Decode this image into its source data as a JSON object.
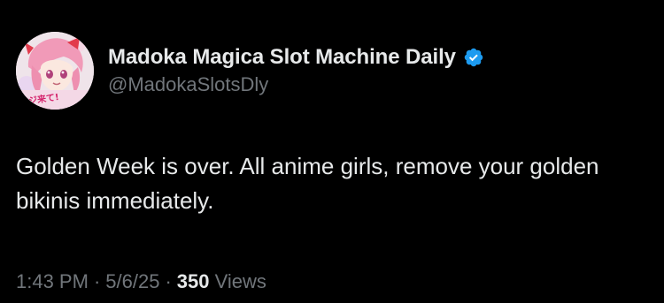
{
  "tweet": {
    "author": {
      "display_name": "Madoka Magica Slot Machine Daily",
      "handle": "@MadokaSlotsDly",
      "verified": true,
      "avatar_icon": "anime-character-avatar",
      "avatar_text": "マジ来て!"
    },
    "text": "Golden Week is over. All anime girls, remove your golden bikinis immediately.",
    "meta": {
      "time": "1:43 PM",
      "separator": "·",
      "date": "5/6/25",
      "views_count": "350",
      "views_label": "Views"
    }
  },
  "colors": {
    "background": "#000000",
    "primary_text": "#e7e9ea",
    "secondary_text": "#71767b",
    "verified_badge": "#1d9bf0"
  }
}
